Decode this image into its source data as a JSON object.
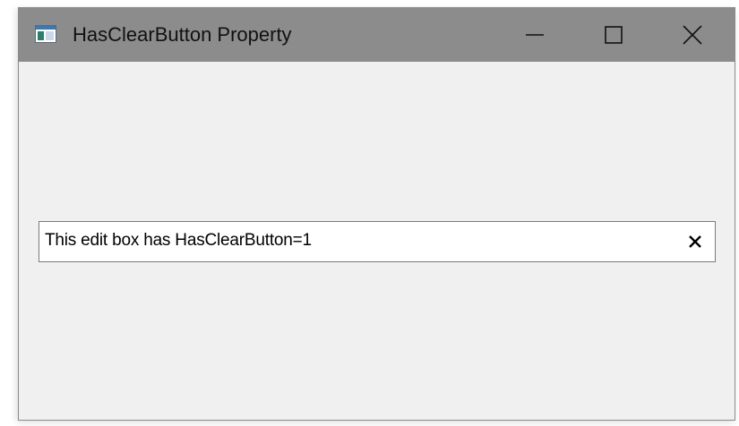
{
  "window": {
    "title": "HasClearButton Property",
    "icon": "app-window-icon",
    "controls": {
      "minimize_icon": "minimize-icon",
      "maximize_icon": "maximize-icon",
      "close_icon": "close-icon"
    },
    "colors": {
      "titlebar": "#8c8c8c",
      "client": "#f0f0f0"
    }
  },
  "edit_box": {
    "value": "This edit box has HasClearButton=1",
    "clear_icon": "clear-x-icon"
  }
}
